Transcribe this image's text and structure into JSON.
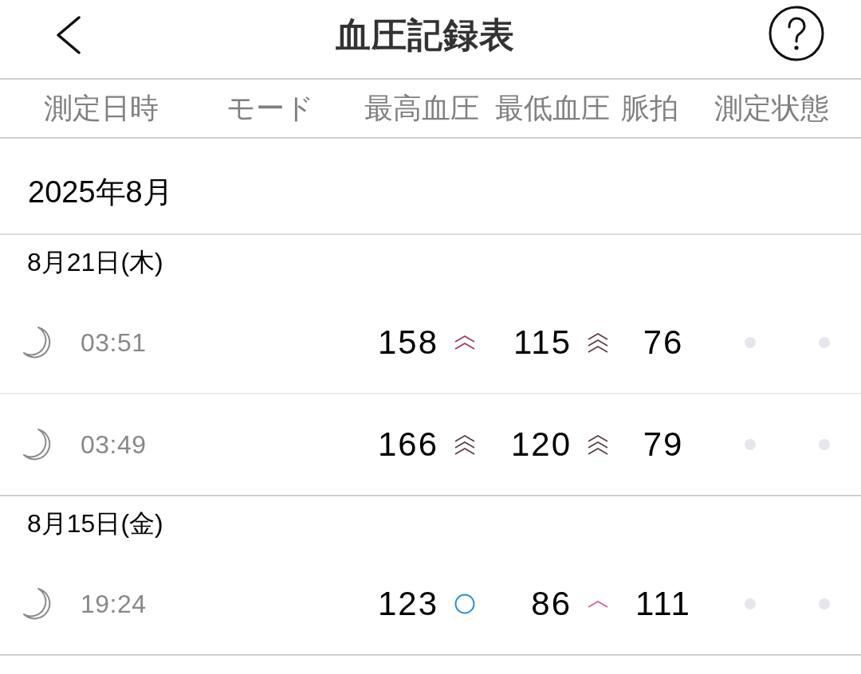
{
  "header": {
    "title": "血圧記録表"
  },
  "columns": [
    "測定日時",
    "モード",
    "最高血圧",
    "最低血圧",
    "脈拍",
    "測定状態"
  ],
  "month": "2025年8月",
  "days": [
    {
      "date": "8月21日(木)",
      "records": [
        {
          "time_icon": {
            "kind": "night"
          },
          "time": "03:51",
          "systolic": "158",
          "systolic_mark": {
            "kind": "double",
            "color": "#9c3a66"
          },
          "diastolic": "115",
          "diastolic_mark": {
            "kind": "triple",
            "color": "#5a3a48"
          },
          "pulse": "76",
          "status_dots": [
            {
              "active": false
            },
            {
              "active": false
            }
          ]
        },
        {
          "time_icon": {
            "kind": "night"
          },
          "time": "03:49",
          "systolic": "166",
          "systolic_mark": {
            "kind": "triple",
            "color": "#5a3a48"
          },
          "diastolic": "120",
          "diastolic_mark": {
            "kind": "triple",
            "color": "#5a3a48"
          },
          "pulse": "79",
          "status_dots": [
            {
              "active": false
            },
            {
              "active": false
            }
          ]
        }
      ]
    },
    {
      "date": "8月15日(金)",
      "records": [
        {
          "time_icon": {
            "kind": "night"
          },
          "time": "19:24",
          "systolic": "123",
          "systolic_mark": {
            "kind": "circle",
            "color": "#2b8fd9"
          },
          "diastolic": "86",
          "diastolic_mark": {
            "kind": "single",
            "color": "#d4609a"
          },
          "pulse": "111",
          "status_dots": [
            {
              "active": false
            },
            {
              "active": false
            }
          ]
        }
      ]
    }
  ]
}
